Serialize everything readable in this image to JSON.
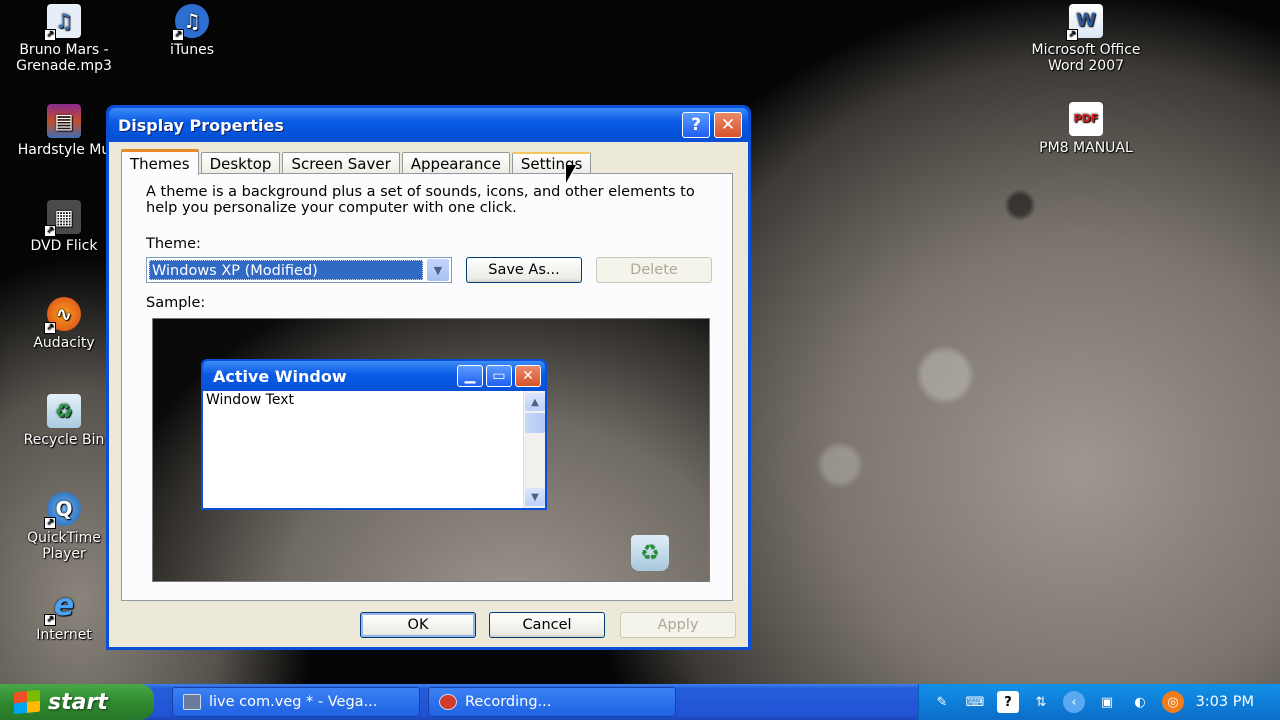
{
  "desktop_icons": [
    {
      "label": "Bruno Mars -\nGrenade.mp3",
      "icon": "music-file-icon",
      "color": "#5a88c7"
    },
    {
      "label": "iTunes",
      "icon": "itunes-icon",
      "color": "#2d6fd1"
    },
    {
      "label": "Hardstyle Mu",
      "icon": "winrar-icon",
      "color": "#8a2b8f"
    },
    {
      "label": "DVD Flick",
      "icon": "dvd-flick-icon",
      "color": "#555555"
    },
    {
      "label": "Audacity",
      "icon": "audacity-icon",
      "color": "#e2641b"
    },
    {
      "label": "Recycle Bin",
      "icon": "recycle-bin-icon",
      "color": "#2a9d4a"
    },
    {
      "label": "QuickTime\nPlayer",
      "icon": "quicktime-icon",
      "color": "#1a73c9"
    },
    {
      "label": "Internet",
      "icon": "internet-explorer-icon",
      "color": "#1e88e5"
    },
    {
      "label": "Microsoft Office\nWord 2007",
      "icon": "word-icon",
      "color": "#2b5797"
    },
    {
      "label": "PM8 MANUAL",
      "icon": "pdf-icon",
      "color": "#d71f1f"
    }
  ],
  "dialog": {
    "title": "Display Properties",
    "help_label": "?",
    "close_label": "✕",
    "tabs": [
      "Themes",
      "Desktop",
      "Screen Saver",
      "Appearance",
      "Settings"
    ],
    "description": "A theme is a background plus a set of sounds, icons, and other elements to help you personalize your computer with one click.",
    "theme_label": "Theme:",
    "theme_value": "Windows XP (Modified)",
    "save_as_label": "Save As...",
    "delete_label": "Delete",
    "sample_label": "Sample:",
    "sample_window": {
      "title": "Active Window",
      "text": "Window Text"
    },
    "ok_label": "OK",
    "cancel_label": "Cancel",
    "apply_label": "Apply"
  },
  "taskbar": {
    "start_label": "start",
    "tasks": [
      {
        "label": "live com.veg * - Vega...",
        "icon": "vegas-icon"
      },
      {
        "label": "Recording...",
        "icon": "recording-icon"
      }
    ],
    "clock": "3:03 PM"
  },
  "colors": {
    "xp_blue": "#0a4fd7",
    "start_green": "#2f8b2f",
    "tray_blue": "#0f7fd9",
    "selection": "#316ac5"
  }
}
